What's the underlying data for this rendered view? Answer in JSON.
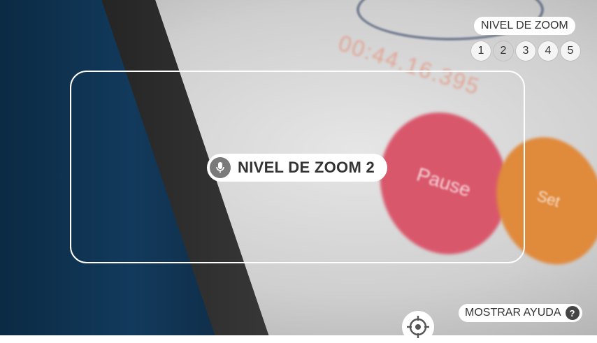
{
  "background": {
    "scene_texts": {
      "timer": "00:44.16.395",
      "pause_label": "Pause",
      "set_label": "Set"
    }
  },
  "center_indicator": {
    "label": "NIVEL DE ZOOM 2",
    "icon": "microphone-icon"
  },
  "zoom_selector": {
    "title": "NIVEL DE ZOOM",
    "levels": [
      "1",
      "2",
      "3",
      "4",
      "5"
    ],
    "active_level": "2"
  },
  "help": {
    "label": "MOSTRAR AYUDA",
    "icon_glyph": "?"
  },
  "focus": {
    "icon": "crosshair-icon"
  },
  "colors": {
    "overlay_white": "#ffffff",
    "text_dark": "#333333",
    "pink_button": "#d9576b",
    "orange_button": "#e08a3c"
  }
}
